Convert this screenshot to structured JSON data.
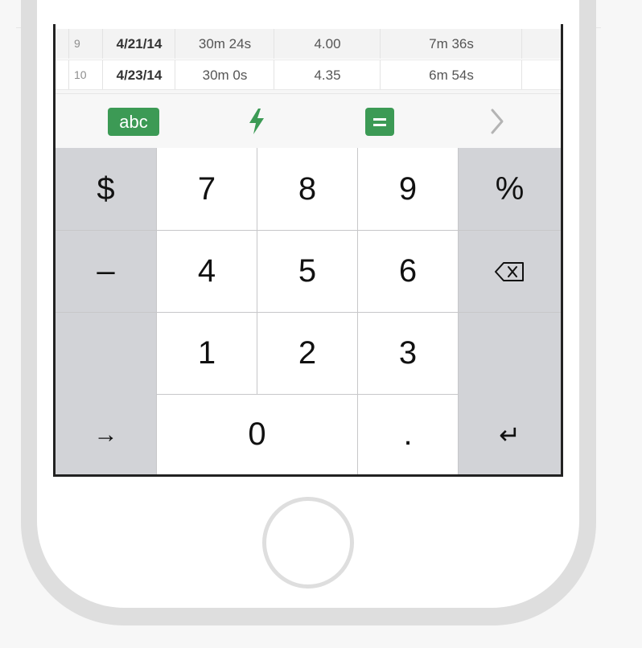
{
  "sheet": {
    "rows": [
      {
        "num": "9",
        "date": "4/21/14",
        "time": "30m 24s",
        "value": "4.00",
        "pace": "7m 36s"
      },
      {
        "num": "10",
        "date": "4/23/14",
        "time": "30m 0s",
        "value": "4.35",
        "pace": "6m 54s"
      }
    ]
  },
  "toolbar": {
    "abc_label": "abc",
    "icons": [
      "lightning-bolt-icon",
      "equals-icon",
      "chevron-right-icon"
    ],
    "accent_color": "#3c9a55"
  },
  "keypad": {
    "dollar": "$",
    "seven": "7",
    "eight": "8",
    "nine": "9",
    "percent": "%",
    "minus": "–",
    "four": "4",
    "five": "5",
    "six": "6",
    "one": "1",
    "two": "2",
    "three": "3",
    "tab": "→",
    "zero": "0",
    "decimal": ".",
    "return": "↵",
    "icons": [
      "backspace-icon"
    ]
  }
}
